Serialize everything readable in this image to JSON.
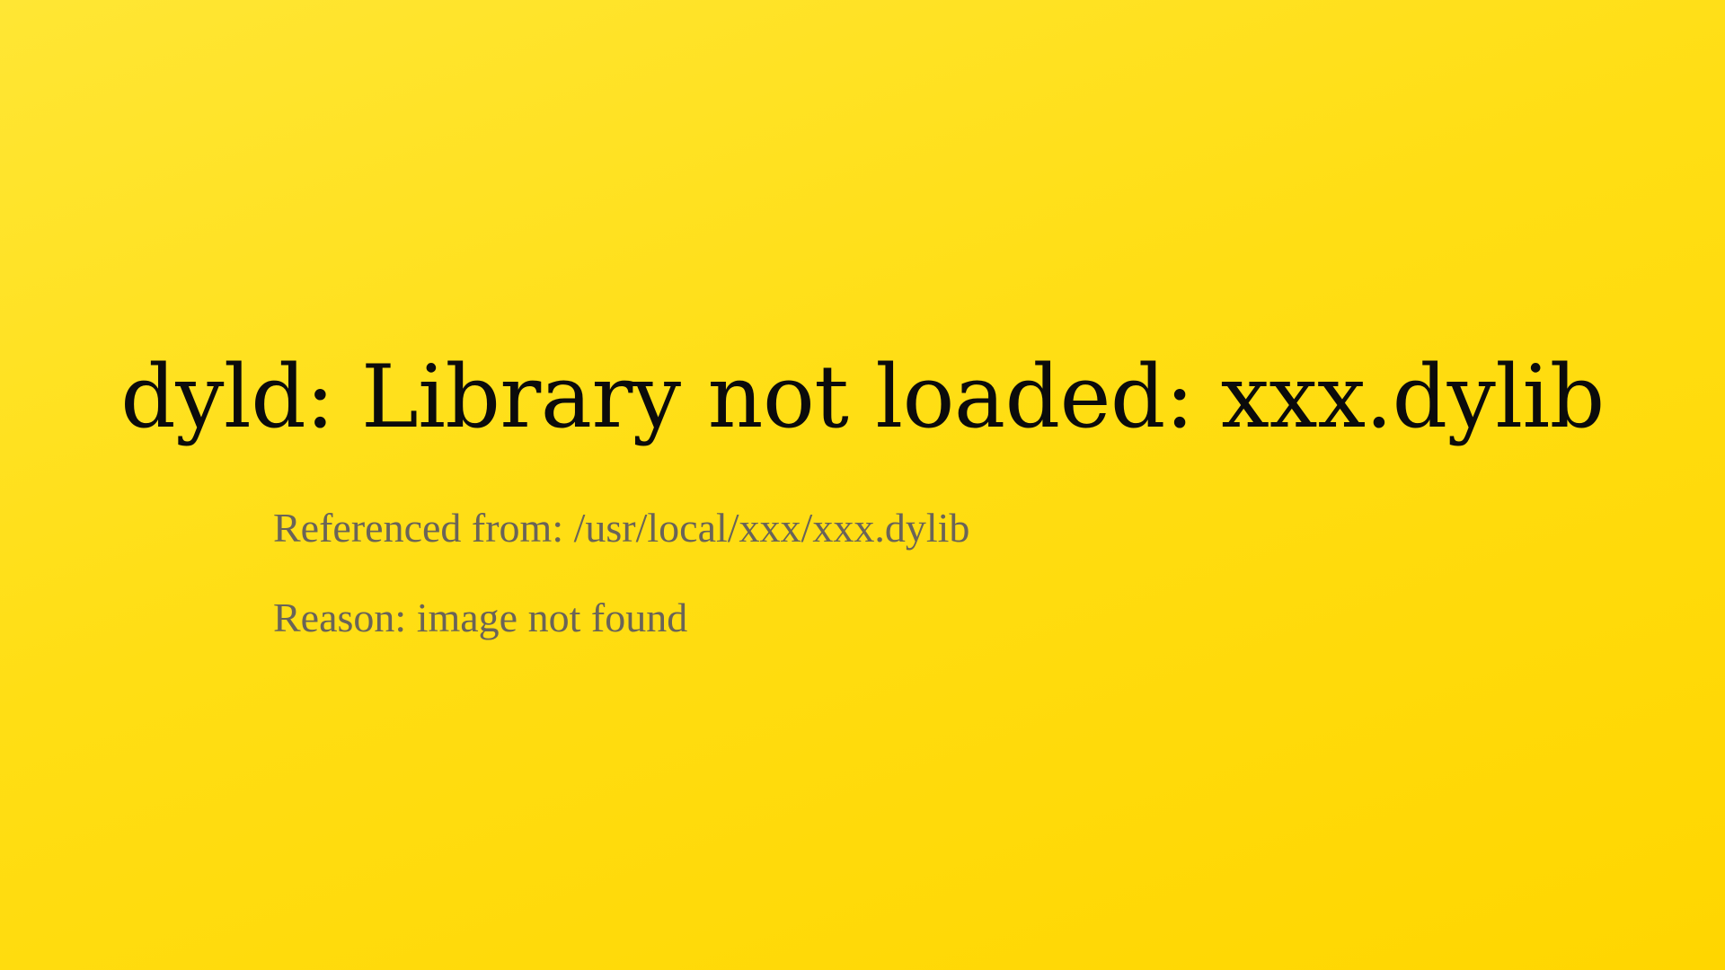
{
  "slide": {
    "title": "dyld: Library not loaded: xxx.dylib",
    "details": [
      "Referenced from: /usr/local/xxx/xxx.dylib",
      "Reason: image not found"
    ],
    "colors": {
      "background_start": "#ffe634",
      "background_end": "#ffd600",
      "title": "#0b0b0b",
      "detail": "#6a6458"
    }
  }
}
